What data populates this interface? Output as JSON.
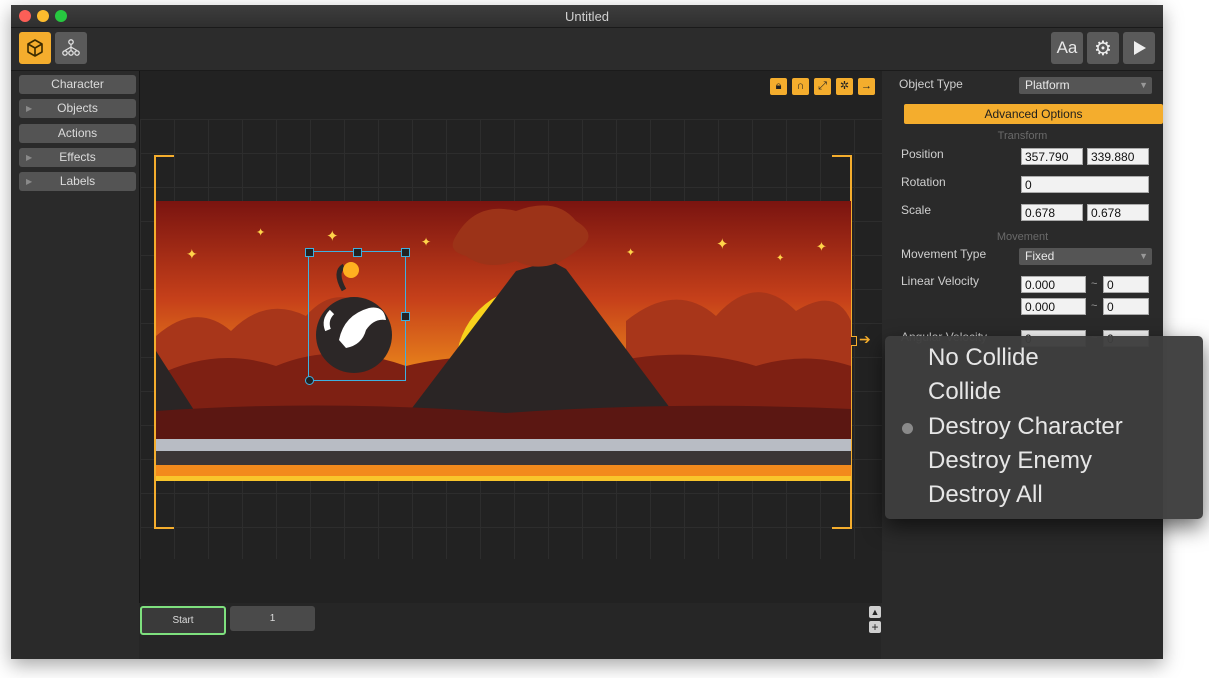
{
  "window": {
    "title": "Untitled"
  },
  "toolbar": {
    "left_icons": [
      "cube-icon",
      "tree-nodes-icon"
    ],
    "font_button_label": "Aa",
    "right_icons": [
      "gear-icon",
      "play-icon"
    ]
  },
  "sidebar": {
    "items": [
      {
        "label": "Character",
        "has_arrow": false
      },
      {
        "label": "Objects",
        "has_arrow": true
      },
      {
        "label": "Actions",
        "has_arrow": false
      },
      {
        "label": "Effects",
        "has_arrow": true
      },
      {
        "label": "Labels",
        "has_arrow": true
      }
    ]
  },
  "stage": {
    "tool_icons": [
      "lock-icon",
      "magnet-icon",
      "link-icon",
      "bug-icon",
      "arrow-right-icon"
    ],
    "object_icon": "bomb-swan-icon"
  },
  "scenes": {
    "items": [
      "Start",
      "1"
    ],
    "selected": "Start"
  },
  "panel": {
    "object_type_label": "Object Type",
    "object_type_value": "Platform",
    "advanced_label": "Advanced Options",
    "transform_header": "Transform",
    "position_label": "Position",
    "position_x": "357.790",
    "position_y": "339.880",
    "rotation_label": "Rotation",
    "rotation_value": "0",
    "scale_label": "Scale",
    "scale_x": "0.678",
    "scale_y": "0.678",
    "movement_header": "Movement",
    "movement_type_label": "Movement Type",
    "movement_type_value": "Fixed",
    "linear_velocity_label": "Linear Velocity",
    "lin_x_min": "0.000",
    "lin_x_max": "0",
    "lin_y_min": "0.000",
    "lin_y_max": "0",
    "angular_velocity_label": "Angular Velocity",
    "ang_min": "0",
    "ang_max": "0",
    "tilde": "~"
  },
  "collision_menu": {
    "items": [
      "No Collide",
      "Collide",
      "Destroy Character",
      "Destroy Enemy",
      "Destroy All"
    ],
    "selected": "Destroy Character"
  },
  "colors": {
    "accent": "#f4ad2d",
    "selection": "#3fb0e0",
    "scene_active_border": "#7ee07e"
  }
}
